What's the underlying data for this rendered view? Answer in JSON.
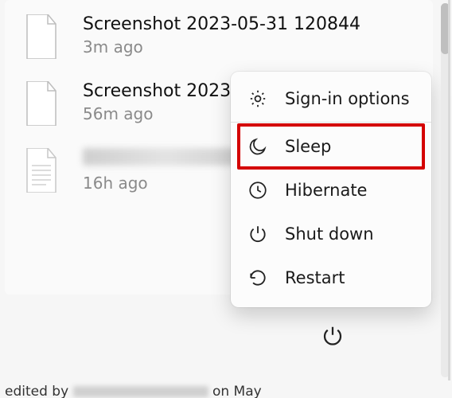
{
  "files": [
    {
      "name": "Screenshot 2023-05-31 120844",
      "time": "3m ago",
      "icon": "blank-page"
    },
    {
      "name": "Screenshot 2023-",
      "time": "56m ago",
      "icon": "blank-page"
    },
    {
      "name_blurred": true,
      "time": "16h ago",
      "icon": "lined-page"
    }
  ],
  "power_menu": {
    "sign_in_options": "Sign-in options",
    "sleep": "Sleep",
    "hibernate": "Hibernate",
    "shut_down": "Shut down",
    "restart": "Restart"
  },
  "highlight": "sleep",
  "colors": {
    "highlight_border": "#d40000"
  },
  "footer": {
    "prefix": "edited by",
    "suffix": "on May"
  }
}
